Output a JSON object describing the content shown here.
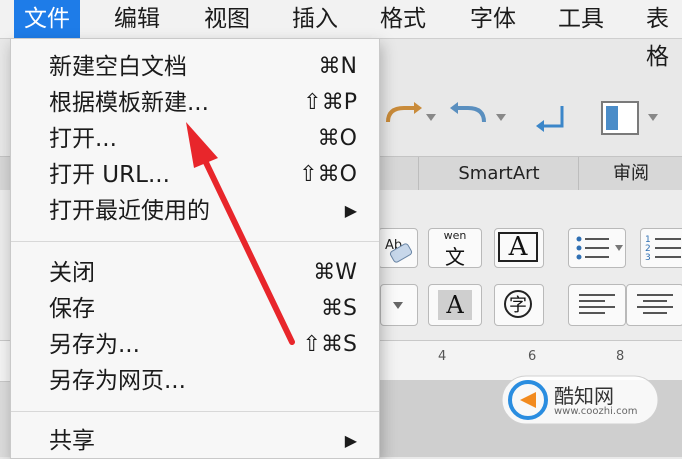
{
  "menubar": {
    "file": "文件",
    "edit": "编辑",
    "view": "视图",
    "insert": "插入",
    "format": "格式",
    "font": "字体",
    "tools": "工具",
    "table": "表格"
  },
  "file_menu": {
    "new_blank": {
      "label": "新建空白文档",
      "shortcut": "⌘N"
    },
    "new_from_template": {
      "label": "根据模板新建...",
      "shortcut": "⇧⌘P"
    },
    "open": {
      "label": "打开...",
      "shortcut": "⌘O"
    },
    "open_url": {
      "label": "打开 URL...",
      "shortcut": "⇧⌘O"
    },
    "open_recent": {
      "label": "打开最近使用的",
      "submenu_arrow": "▶"
    },
    "close": {
      "label": "关闭",
      "shortcut": "⌘W"
    },
    "save": {
      "label": "保存",
      "shortcut": "⌘S"
    },
    "save_as": {
      "label": "另存为...",
      "shortcut": "⇧⌘S"
    },
    "save_as_web": {
      "label": "另存为网页..."
    },
    "share": {
      "label": "共享",
      "submenu_arrow": "▶"
    }
  },
  "ribbon": {
    "tabs": [
      "SmartArt",
      "审阅"
    ],
    "ruler_ticks": [
      "4",
      "6",
      "8"
    ],
    "buttons": {
      "phonetic": {
        "top": "wen",
        "bottom": "文"
      },
      "char_border": "A",
      "char_shading": "A",
      "enclose_char": "字"
    }
  },
  "watermark": {
    "name": "酷知网",
    "url": "www.coozhi.com"
  },
  "colors": {
    "active_menu": "#1e7ce8",
    "arrow": "#e8262b",
    "watermark_blue": "#2a8de0"
  }
}
